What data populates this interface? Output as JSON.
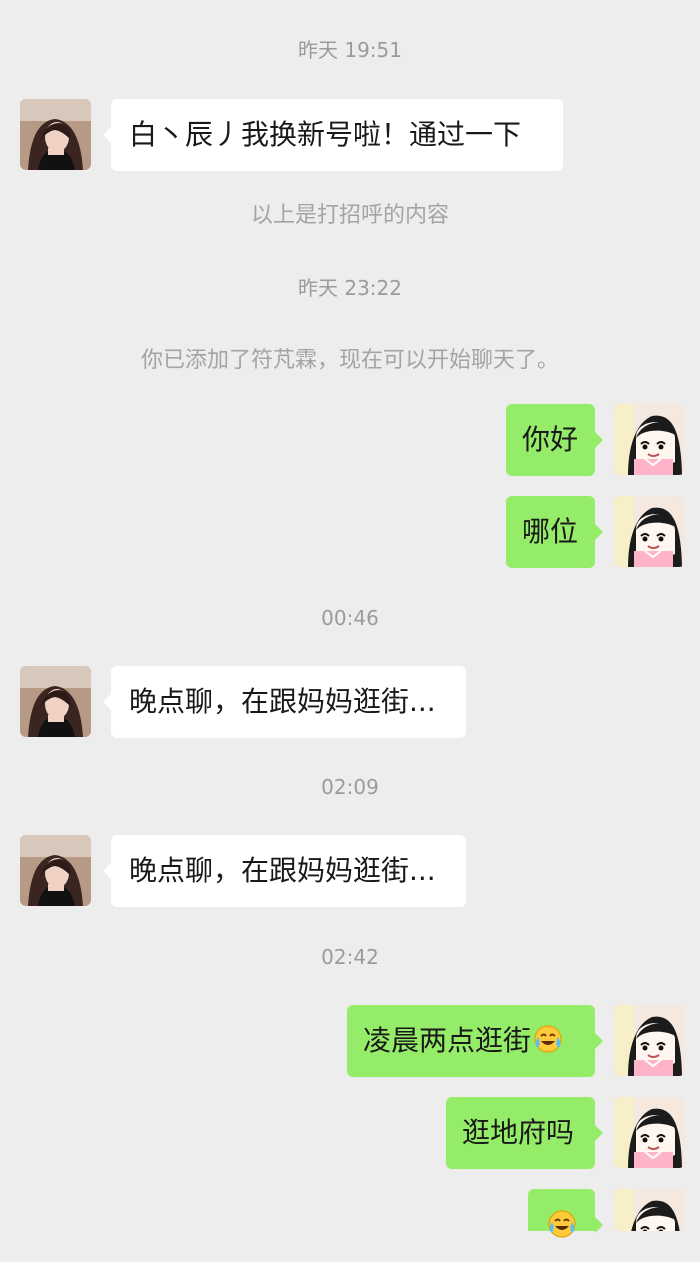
{
  "conversation": {
    "timestamps": [
      "昨天 19:51",
      "昨天 23:22",
      "00:46",
      "02:09",
      "02:42"
    ],
    "system_messages": [
      "以上是打招呼的内容",
      "你已添加了符芃霖，现在可以开始聊天了。"
    ],
    "messages": [
      {
        "side": "left",
        "text": "白丶辰丿我换新号啦！通过一下"
      },
      {
        "side": "right",
        "text": "你好"
      },
      {
        "side": "right",
        "text": "哪位"
      },
      {
        "side": "left",
        "text": "晚点聊，在跟妈妈逛街..."
      },
      {
        "side": "left",
        "text": "晚点聊，在跟妈妈逛街..."
      },
      {
        "side": "right",
        "text": "凌晨两点逛街",
        "emoji": "laughing-crying-emoji"
      },
      {
        "side": "right",
        "text": "逛地府吗"
      },
      {
        "side": "right",
        "text": "",
        "emoji": "laughing-crying-emoji"
      }
    ]
  },
  "theme": {
    "background": "#ededed",
    "incoming_bubble": "#ffffff",
    "outgoing_bubble": "#95ec69",
    "timestamp_color": "#9b9b9b"
  }
}
